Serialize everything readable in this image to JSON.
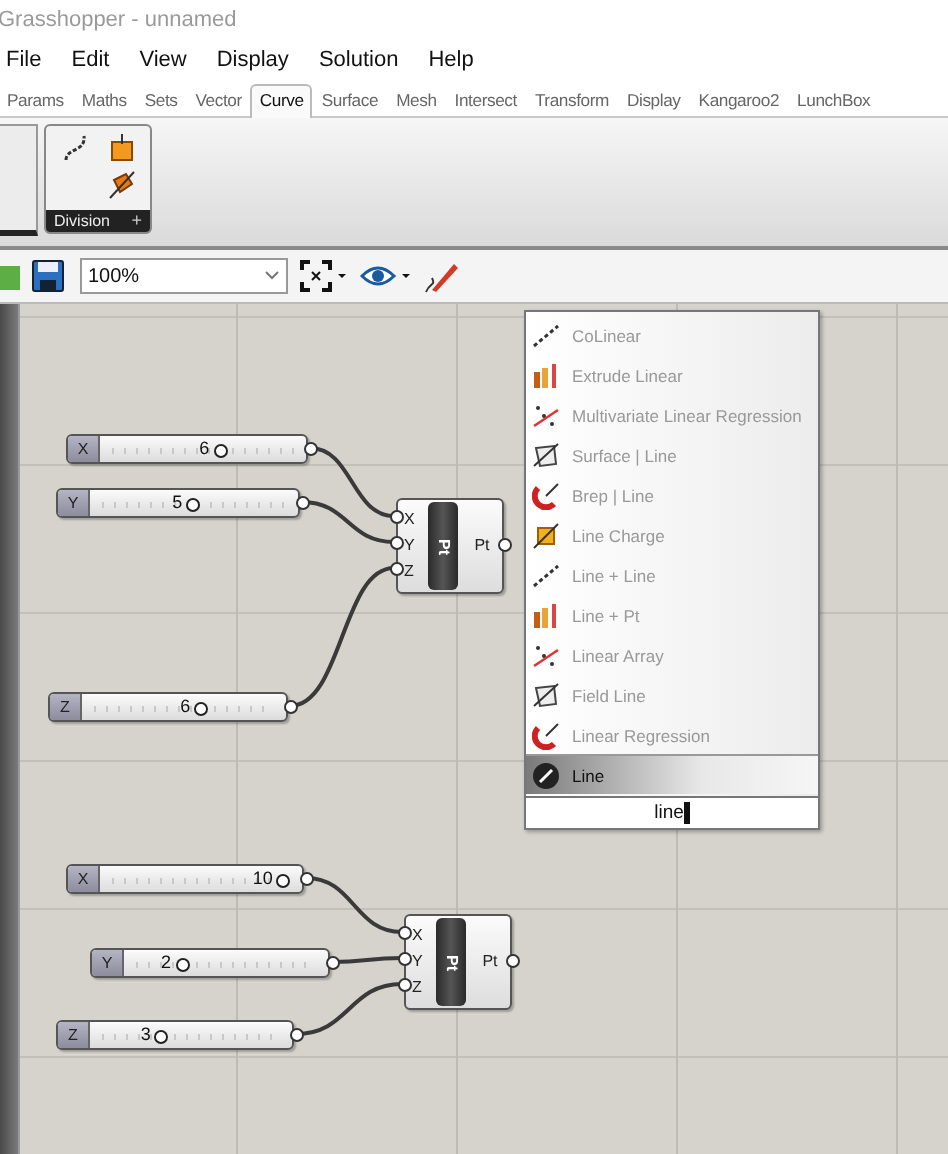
{
  "window": {
    "title": "Grasshopper - unnamed"
  },
  "menu": [
    "File",
    "Edit",
    "View",
    "Display",
    "Solution",
    "Help"
  ],
  "tabs": [
    {
      "label": "Params",
      "selected": false
    },
    {
      "label": "Maths",
      "selected": false
    },
    {
      "label": "Sets",
      "selected": false
    },
    {
      "label": "Vector",
      "selected": false
    },
    {
      "label": "Curve",
      "selected": true
    },
    {
      "label": "Surface",
      "selected": false
    },
    {
      "label": "Mesh",
      "selected": false
    },
    {
      "label": "Intersect",
      "selected": false
    },
    {
      "label": "Transform",
      "selected": false
    },
    {
      "label": "Display",
      "selected": false
    },
    {
      "label": "Kangaroo2",
      "selected": false
    },
    {
      "label": "LunchBox",
      "selected": false
    }
  ],
  "ribbon": {
    "panel": "Division",
    "expand": "+"
  },
  "toolbar": {
    "zoom": "100%"
  },
  "sliders": [
    {
      "label": "X",
      "value": "6",
      "level": 0.59
    },
    {
      "label": "Y",
      "value": "5",
      "level": 0.49
    },
    {
      "label": "Z",
      "value": "6",
      "level": 0.59
    },
    {
      "label": "X",
      "value": "10",
      "level": 0.96
    },
    {
      "label": "Y",
      "value": "2",
      "level": 0.25
    },
    {
      "label": "Z",
      "value": "3",
      "level": 0.33
    }
  ],
  "nodes": [
    {
      "inputs": [
        "X",
        "Y",
        "Z"
      ],
      "title": "Pt",
      "output": "Pt"
    },
    {
      "inputs": [
        "X",
        "Y",
        "Z"
      ],
      "title": "Pt",
      "output": "Pt"
    }
  ],
  "search_popup": {
    "items": [
      {
        "label": "CoLinear",
        "selected": false
      },
      {
        "label": "Extrude Linear",
        "selected": false
      },
      {
        "label": "Multivariate Linear Regression",
        "selected": false
      },
      {
        "label": "Surface | Line",
        "selected": false
      },
      {
        "label": "Brep | Line",
        "selected": false
      },
      {
        "label": "Line Charge",
        "selected": false
      },
      {
        "label": "Line + Line",
        "selected": false
      },
      {
        "label": "Line + Pt",
        "selected": false
      },
      {
        "label": "Linear Array",
        "selected": false
      },
      {
        "label": "Field Line",
        "selected": false
      },
      {
        "label": "Linear Regression",
        "selected": false
      },
      {
        "label": "Line",
        "selected": true
      }
    ],
    "query": "line"
  }
}
